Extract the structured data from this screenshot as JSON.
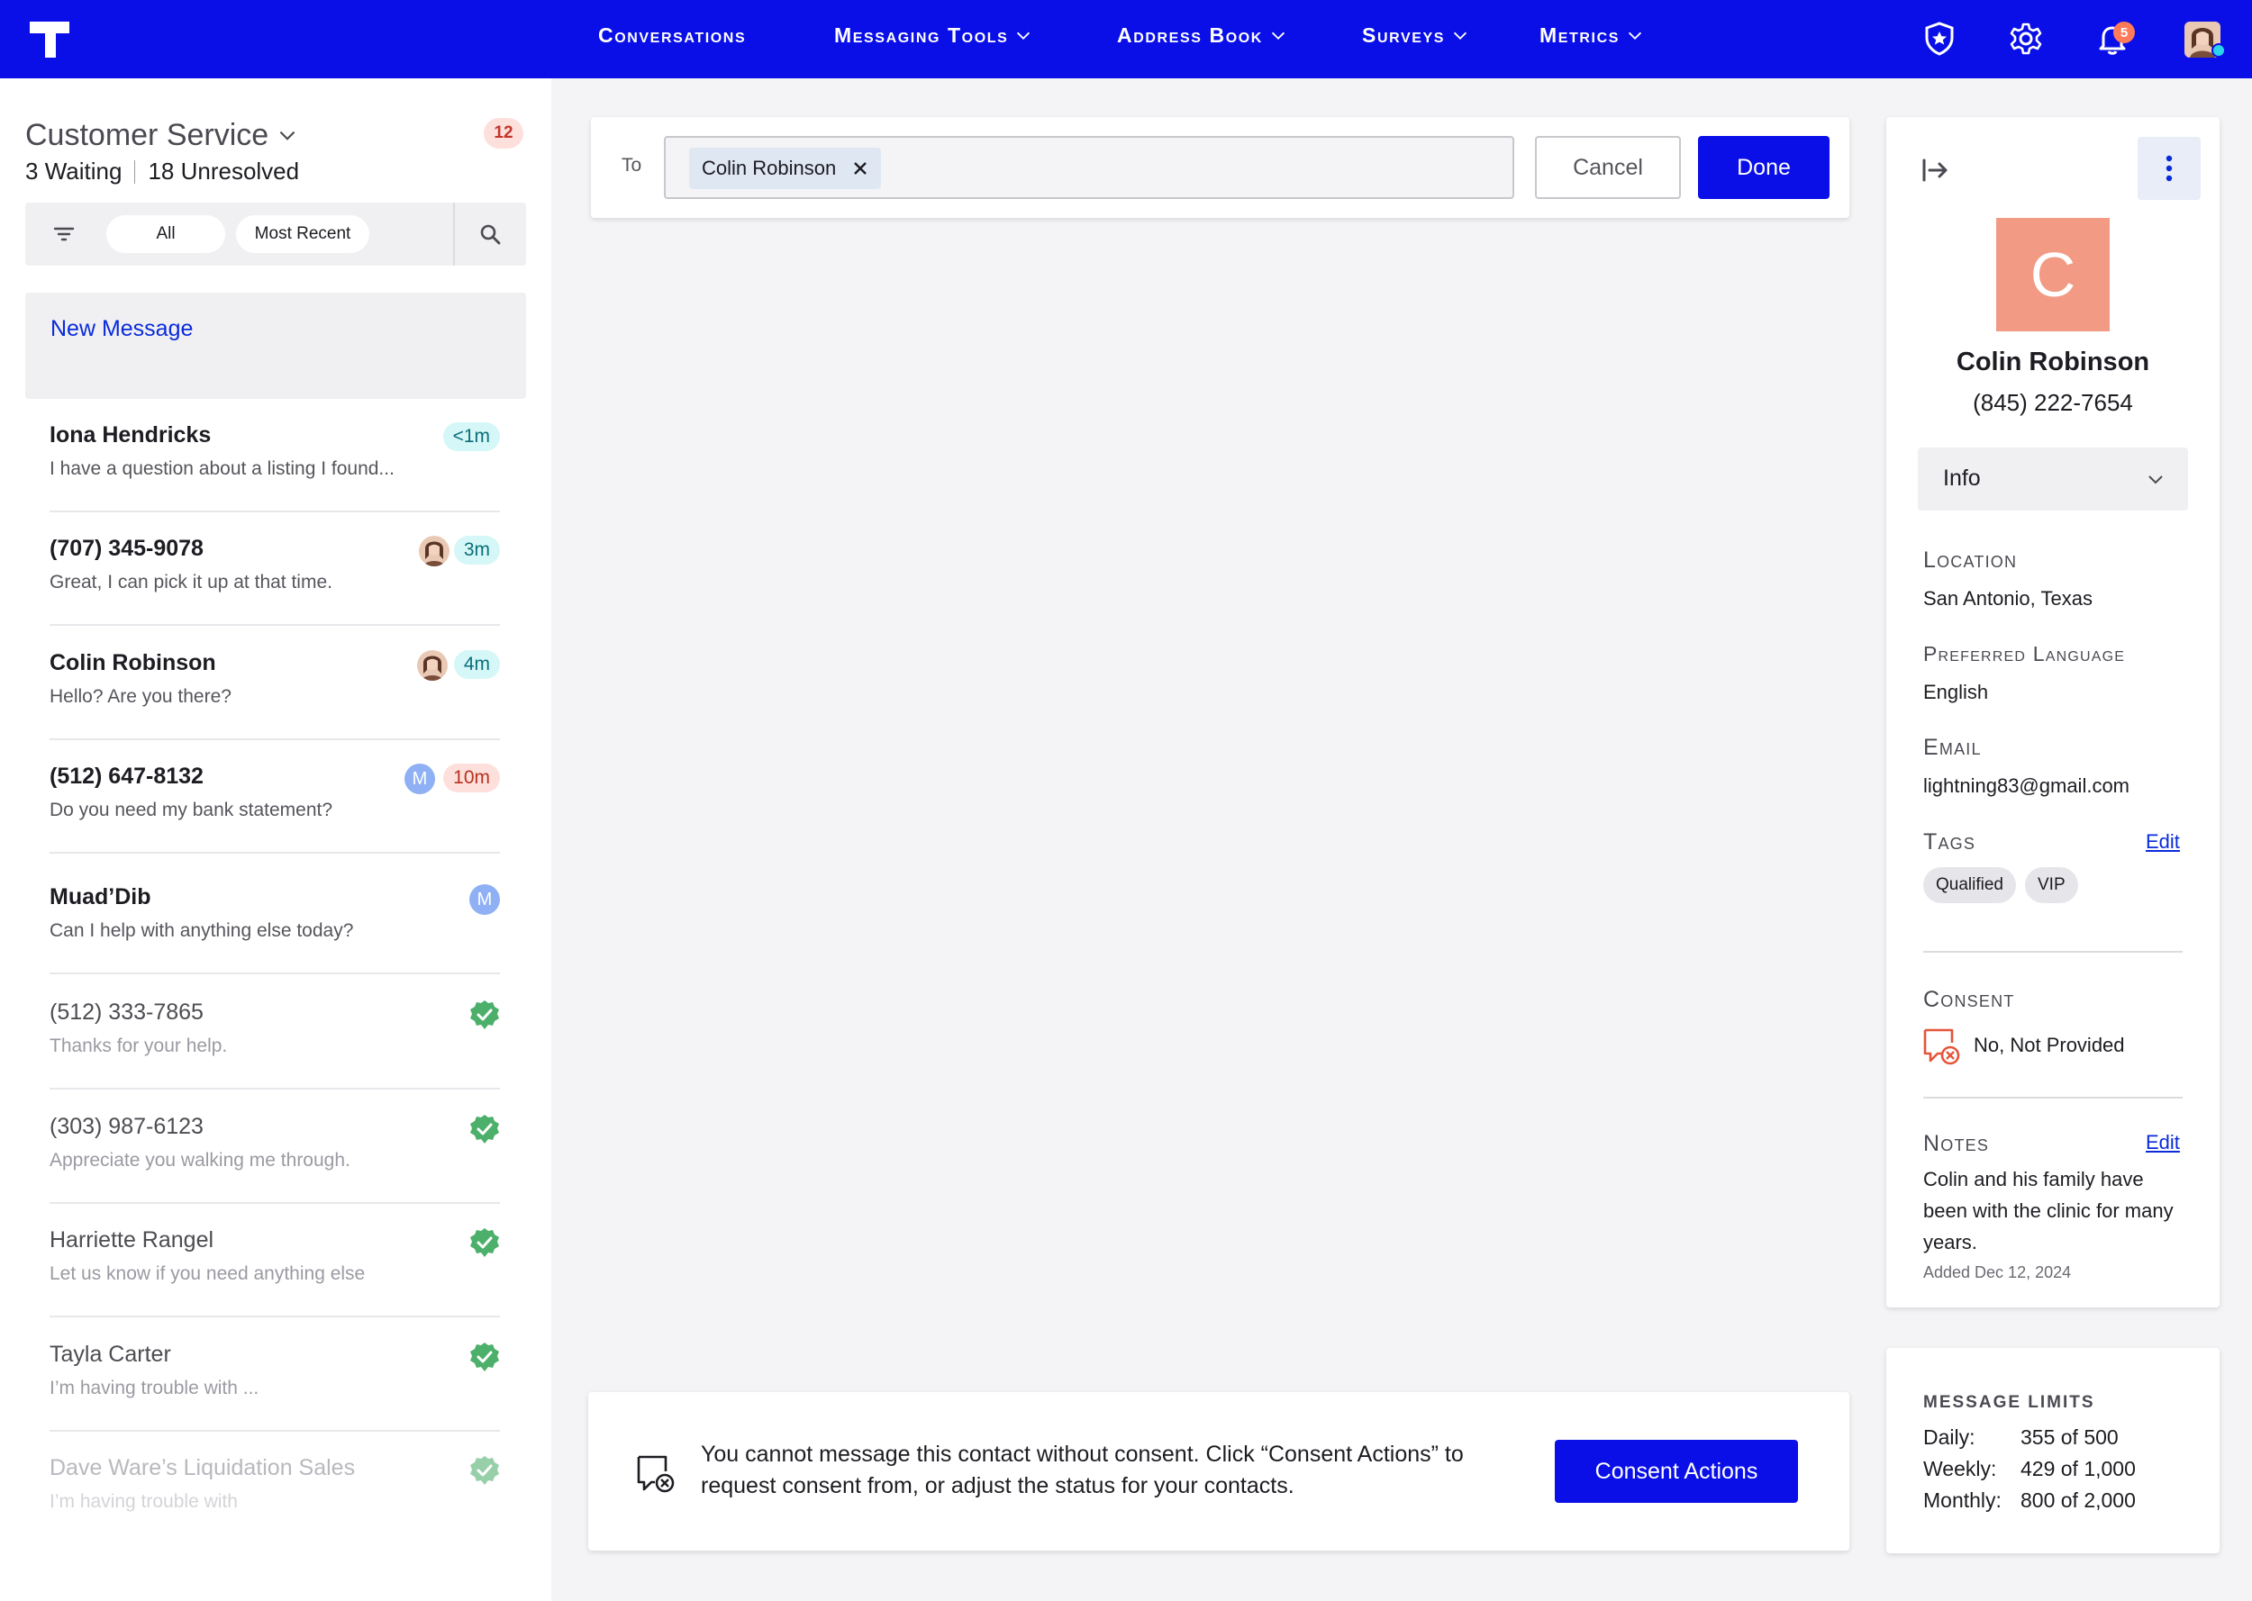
{
  "nav": {
    "items": [
      {
        "label": "Conversations",
        "dropdown": false
      },
      {
        "label": "Messaging Tools",
        "dropdown": true
      },
      {
        "label": "Address Book",
        "dropdown": true
      },
      {
        "label": "Surveys",
        "dropdown": true
      },
      {
        "label": "Metrics",
        "dropdown": true
      }
    ],
    "notification_count": "5",
    "icons": [
      "app-logo-icon",
      "shield-star-icon",
      "gear-icon",
      "bell-icon",
      "user-avatar"
    ]
  },
  "inbox": {
    "title": "Customer Service",
    "count": "12",
    "waiting_count": "3",
    "waiting_label": "Waiting",
    "unresolved_count": "18",
    "unresolved_label": "Unresolved",
    "filter_all": "All",
    "filter_sort": "Most Recent",
    "new_message": "New Message"
  },
  "conversations": [
    {
      "name": "Iona Hendricks",
      "preview": "I have a question about a listing I found...",
      "time": "<1m",
      "time_style": "teal",
      "assignee": "none",
      "state": "unread"
    },
    {
      "name": "(707) 345-9078",
      "preview": "Great, I can pick it up at that time.",
      "time": "3m",
      "time_style": "teal",
      "assignee": "photo",
      "state": "unread"
    },
    {
      "name": "Colin Robinson",
      "preview": "Hello? Are you there?",
      "time": "4m",
      "time_style": "teal",
      "assignee": "photo",
      "state": "unread"
    },
    {
      "name": "(512) 647-8132",
      "preview": "Do you need my bank statement?",
      "time": "10m",
      "time_style": "red",
      "assignee": "M",
      "state": "unread"
    },
    {
      "name": "Muad’Dib",
      "preview": "Can I help with anything else today?",
      "time": "",
      "time_style": "",
      "assignee": "M",
      "state": "unread"
    },
    {
      "name": "(512) 333-7865",
      "preview": "Thanks for your help.",
      "time": "",
      "time_style": "",
      "assignee": "resolved",
      "state": "resolved"
    },
    {
      "name": "(303) 987-6123",
      "preview": "Appreciate you walking me through.",
      "time": "",
      "time_style": "",
      "assignee": "resolved",
      "state": "resolved"
    },
    {
      "name": "Harriette Rangel",
      "preview": "Let us know if you need anything else",
      "time": "",
      "time_style": "",
      "assignee": "resolved",
      "state": "resolved"
    },
    {
      "name": "Tayla Carter",
      "preview": "I’m having trouble with ...",
      "time": "",
      "time_style": "",
      "assignee": "resolved",
      "state": "resolved"
    },
    {
      "name": "Dave Ware’s Liquidation Sales",
      "preview": "I’m having trouble with",
      "time": "",
      "time_style": "",
      "assignee": "resolved",
      "state": "faded"
    }
  ],
  "compose": {
    "to_label": "To",
    "recipient": "Colin Robinson",
    "cancel": "Cancel",
    "done": "Done"
  },
  "consent_notice": {
    "text": "You cannot message this contact without consent. Click “Consent Actions” to request consent from, or adjust the status for your contacts.",
    "button": "Consent Actions"
  },
  "contact": {
    "initial": "C",
    "name": "Colin Robinson",
    "phone": "(845) 222-7654",
    "section_select": "Info",
    "location_label": "Location",
    "location": "San Antonio, Texas",
    "language_label": "Preferred Language",
    "language": "English",
    "email_label": "Email",
    "email": "lightning83@gmail.com",
    "tags_label": "Tags",
    "tags_edit": "Edit",
    "tags": [
      "Qualified",
      "VIP"
    ],
    "consent_label": "Consent",
    "consent_status": "No, Not Provided",
    "notes_label": "Notes",
    "notes_edit": "Edit",
    "notes": "Colin and his family have been with the clinic for many years.",
    "notes_date": "Added Dec 12, 2024",
    "avatar_color": "#f29a84"
  },
  "limits": {
    "title": "MESSAGE LIMITS",
    "rows": [
      {
        "label": "Daily:",
        "value": "355 of 500"
      },
      {
        "label": "Weekly:",
        "value": "429 of 1,000"
      },
      {
        "label": "Monthly:",
        "value": "800 of 2,000"
      }
    ]
  },
  "colors": {
    "brand": "#0a0fe8",
    "link": "#0a2bd9",
    "success": "#4caf6a",
    "alert": "#e4553a"
  }
}
